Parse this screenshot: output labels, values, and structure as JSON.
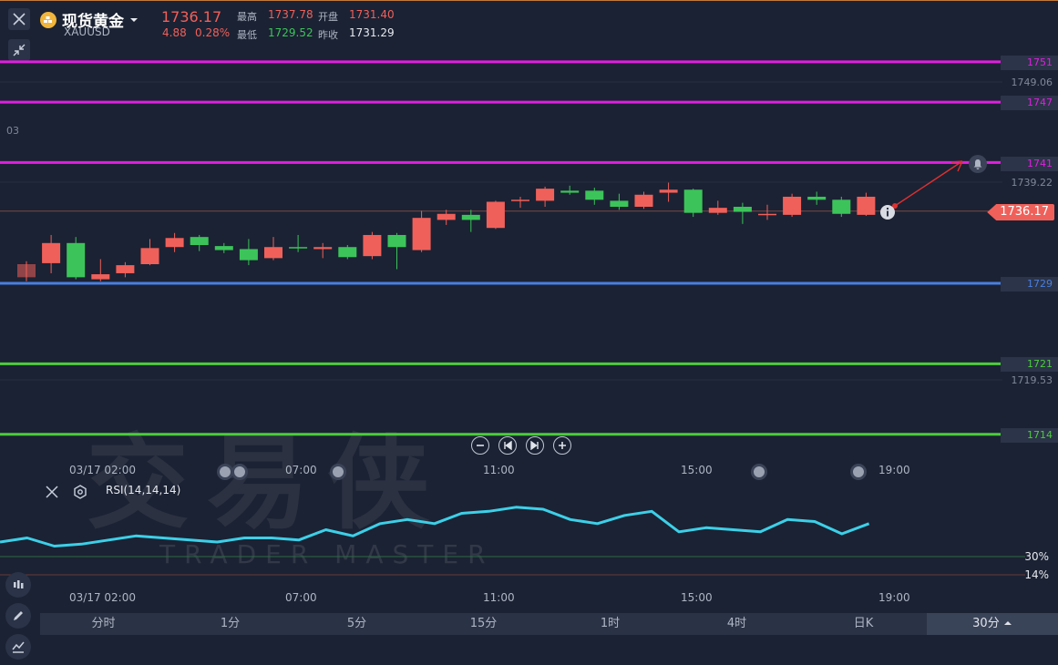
{
  "header": {
    "name": "现货黄金",
    "code": "XAUUSD",
    "price": "1736.17",
    "change": "4.88",
    "change_pct": "0.28%",
    "high_label": "最高",
    "high": "1737.78",
    "open_label": "开盘",
    "open": "1731.40",
    "low_label": "最低",
    "low": "1729.52",
    "prev_label": "昨收",
    "prev": "1731.29"
  },
  "price_axis": {
    "lines": [
      "1751",
      "1747",
      "1741",
      "1729",
      "1721",
      "1714"
    ],
    "grid": [
      "1749.06",
      "1739.22",
      "1719.53"
    ],
    "left_fragment": "03",
    "current": "1736.17"
  },
  "time_axis_main": [
    "03/17 02:00",
    "07:00",
    "11:00",
    "15:00",
    "19:00"
  ],
  "time_axis_rsi": [
    "03/17 02:00",
    "07:00",
    "11:00",
    "15:00",
    "19:00"
  ],
  "rsi": {
    "label": "RSI(14,14,14)",
    "levels": [
      "30%",
      "14%"
    ]
  },
  "tabs": [
    "分时",
    "1分",
    "5分",
    "15分",
    "1时",
    "4时",
    "日K",
    "30分"
  ],
  "active_tab": "30分",
  "watermark": {
    "cn": "交易侠",
    "en": "TRADER MASTER"
  },
  "colors": {
    "up": "#f0605a",
    "down": "#3cc45a",
    "magenta": "#e020e0",
    "blue": "#4a7fe0",
    "green": "#4ccd3c",
    "rsi": "#3cd0e8"
  },
  "chart_data": {
    "type": "candlestick",
    "ylim": [
      1710,
      1752
    ],
    "candles": [
      {
        "o": 1729.6,
        "h": 1731.2,
        "l": 1729.2,
        "c": 1730.9
      },
      {
        "o": 1731.0,
        "h": 1733.8,
        "l": 1730.0,
        "c": 1733.0
      },
      {
        "o": 1733.0,
        "h": 1733.6,
        "l": 1729.4,
        "c": 1729.6
      },
      {
        "o": 1729.4,
        "h": 1731.4,
        "l": 1729.2,
        "c": 1729.9
      },
      {
        "o": 1730.0,
        "h": 1731.1,
        "l": 1729.6,
        "c": 1730.8
      },
      {
        "o": 1730.9,
        "h": 1733.4,
        "l": 1730.8,
        "c": 1732.5
      },
      {
        "o": 1732.6,
        "h": 1734.0,
        "l": 1732.1,
        "c": 1733.5
      },
      {
        "o": 1733.6,
        "h": 1733.8,
        "l": 1732.2,
        "c": 1732.8
      },
      {
        "o": 1732.7,
        "h": 1733.0,
        "l": 1732.0,
        "c": 1732.3
      },
      {
        "o": 1732.4,
        "h": 1733.4,
        "l": 1730.8,
        "c": 1731.3
      },
      {
        "o": 1731.5,
        "h": 1733.6,
        "l": 1731.3,
        "c": 1732.6
      },
      {
        "o": 1732.6,
        "h": 1733.8,
        "l": 1732.1,
        "c": 1732.5
      },
      {
        "o": 1732.4,
        "h": 1733.0,
        "l": 1731.5,
        "c": 1732.6
      },
      {
        "o": 1732.6,
        "h": 1732.8,
        "l": 1731.4,
        "c": 1731.6
      },
      {
        "o": 1731.7,
        "h": 1734.1,
        "l": 1731.4,
        "c": 1733.8
      },
      {
        "o": 1733.8,
        "h": 1734.0,
        "l": 1730.4,
        "c": 1732.6
      },
      {
        "o": 1732.3,
        "h": 1736.2,
        "l": 1732.1,
        "c": 1735.5
      },
      {
        "o": 1735.3,
        "h": 1736.3,
        "l": 1734.8,
        "c": 1735.9
      },
      {
        "o": 1735.8,
        "h": 1736.3,
        "l": 1734.1,
        "c": 1735.3
      },
      {
        "o": 1734.5,
        "h": 1737.2,
        "l": 1734.4,
        "c": 1737.1
      },
      {
        "o": 1737.2,
        "h": 1737.6,
        "l": 1736.5,
        "c": 1737.3
      },
      {
        "o": 1737.2,
        "h": 1738.6,
        "l": 1736.6,
        "c": 1738.4
      },
      {
        "o": 1738.2,
        "h": 1738.7,
        "l": 1737.8,
        "c": 1738.0
      },
      {
        "o": 1738.2,
        "h": 1738.5,
        "l": 1736.8,
        "c": 1737.3
      },
      {
        "o": 1737.2,
        "h": 1737.9,
        "l": 1736.3,
        "c": 1736.6
      },
      {
        "o": 1736.6,
        "h": 1738.1,
        "l": 1736.4,
        "c": 1737.8
      },
      {
        "o": 1738.0,
        "h": 1739.0,
        "l": 1737.1,
        "c": 1738.3
      },
      {
        "o": 1738.3,
        "h": 1738.4,
        "l": 1735.6,
        "c": 1736.0
      },
      {
        "o": 1736.0,
        "h": 1737.2,
        "l": 1735.8,
        "c": 1736.5
      },
      {
        "o": 1736.6,
        "h": 1737.0,
        "l": 1734.9,
        "c": 1736.1
      },
      {
        "o": 1735.9,
        "h": 1736.8,
        "l": 1735.3,
        "c": 1735.9
      },
      {
        "o": 1735.8,
        "h": 1737.9,
        "l": 1735.6,
        "c": 1737.6
      },
      {
        "o": 1737.6,
        "h": 1738.1,
        "l": 1736.8,
        "c": 1737.3
      },
      {
        "o": 1737.3,
        "h": 1737.6,
        "l": 1735.6,
        "c": 1735.9
      },
      {
        "o": 1735.8,
        "h": 1738.0,
        "l": 1735.7,
        "c": 1737.6
      }
    ],
    "rsi_values": [
      40,
      42,
      38,
      39,
      41,
      43,
      42,
      41,
      40,
      42,
      42,
      41,
      46,
      43,
      49,
      51,
      49,
      54,
      55,
      57,
      56,
      51,
      49,
      53,
      55,
      45,
      47,
      46,
      45,
      51,
      50,
      44,
      49
    ]
  }
}
